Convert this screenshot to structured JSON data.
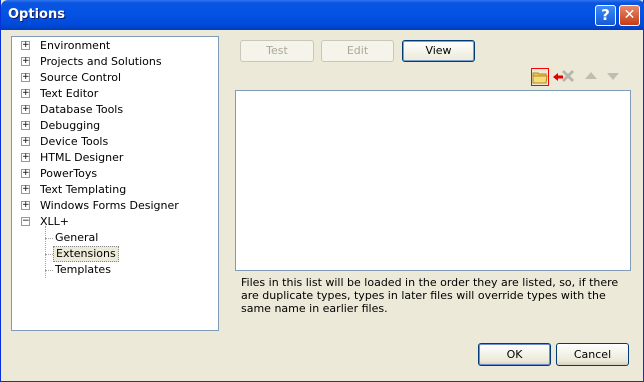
{
  "window": {
    "title": "Options"
  },
  "tree": {
    "items": [
      {
        "label": "Environment",
        "expander": "+"
      },
      {
        "label": "Projects and Solutions",
        "expander": "+"
      },
      {
        "label": "Source Control",
        "expander": "+"
      },
      {
        "label": "Text Editor",
        "expander": "+"
      },
      {
        "label": "Database Tools",
        "expander": "+"
      },
      {
        "label": "Debugging",
        "expander": "+"
      },
      {
        "label": "Device Tools",
        "expander": "+"
      },
      {
        "label": "HTML Designer",
        "expander": "+"
      },
      {
        "label": "PowerToys",
        "expander": "+"
      },
      {
        "label": "Text Templating",
        "expander": "+"
      },
      {
        "label": "Windows Forms Designer",
        "expander": "+"
      },
      {
        "label": "XLL+",
        "expander": "−"
      }
    ],
    "children": [
      {
        "label": "General"
      },
      {
        "label": "Extensions"
      },
      {
        "label": "Templates"
      }
    ],
    "selected": "Extensions"
  },
  "panel": {
    "buttons": {
      "test": "Test",
      "edit": "Edit",
      "view": "View"
    },
    "note": "Files in this list will be loaded in the order they are listed, so, if there are duplicate types, types in later files will override types with the same name in earlier files."
  },
  "dialog": {
    "ok": "OK",
    "cancel": "Cancel"
  },
  "colors": {
    "title_bar": "#0453e5",
    "dialog_bg": "#ece9d8",
    "highlight": "#ff0000"
  }
}
